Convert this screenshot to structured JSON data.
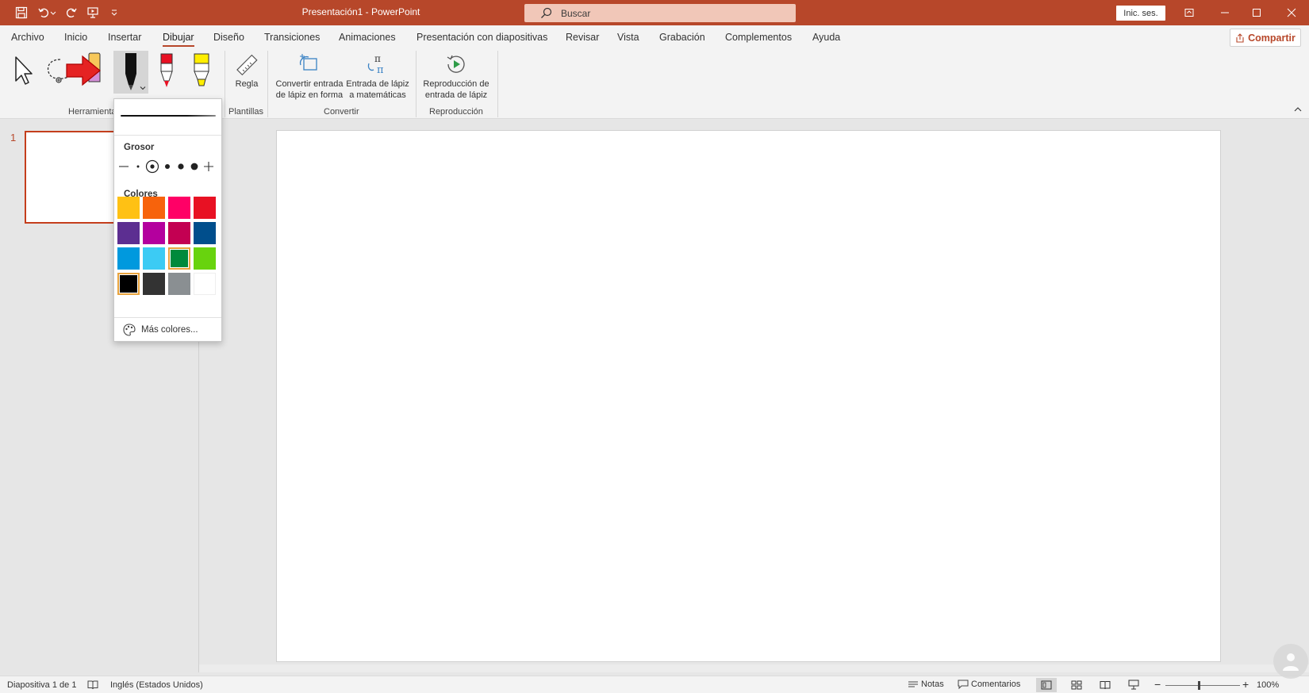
{
  "titlebar": {
    "title": "Presentación1  -  PowerPoint",
    "search_placeholder": "Buscar",
    "signin_label": "Inic. ses."
  },
  "menu": {
    "tabs": [
      {
        "label": "Archivo"
      },
      {
        "label": "Inicio"
      },
      {
        "label": "Insertar"
      },
      {
        "label": "Dibujar",
        "active": true
      },
      {
        "label": "Diseño"
      },
      {
        "label": "Transiciones"
      },
      {
        "label": "Animaciones"
      },
      {
        "label": "Presentación con diapositivas"
      },
      {
        "label": "Revisar"
      },
      {
        "label": "Vista"
      },
      {
        "label": "Grabación"
      },
      {
        "label": "Complementos"
      },
      {
        "label": "Ayuda"
      }
    ],
    "share_label": "Compartir"
  },
  "ribbon": {
    "groups": {
      "herramientas": "Herramienta",
      "plantillas": "Plantillas",
      "convertir": "Convertir",
      "reproduccion": "Reproducción"
    },
    "tools": {
      "regla": "Regla",
      "convert_shape_1": "Convertir entrada",
      "convert_shape_2": "de lápiz en forma",
      "convert_math_1": "Entrada de lápiz",
      "convert_math_2": "a matemáticas",
      "replay_1": "Reproducción de",
      "replay_2": "entrada de lápiz"
    }
  },
  "pen_popup": {
    "thickness_title": "Grosor",
    "colors_title": "Colores",
    "more_colors": "Más colores...",
    "selected_thickness_index": 2,
    "colors": [
      "#FFC114",
      "#F7630C",
      "#FF0066",
      "#E81123",
      "#5C2E91",
      "#B4009E",
      "#C30052",
      "#004E8C",
      "#0099DE",
      "#3CCBF4",
      "#008A3C",
      "#68D30E",
      "#000000",
      "#333333",
      "#8A8F92",
      "#FFFFFF"
    ],
    "selected_color_indices": [
      10,
      12
    ]
  },
  "slides_pane": {
    "slide_number": "1"
  },
  "statusbar": {
    "slide_info": "Diapositiva 1 de 1",
    "language": "Inglés (Estados Unidos)",
    "notes": "Notas",
    "comments": "Comentarios",
    "zoom_minus": "−",
    "zoom_plus": "+",
    "zoom_level": "100%",
    "zoom_fraction": 0.45
  },
  "accent_color": "#B7472A"
}
